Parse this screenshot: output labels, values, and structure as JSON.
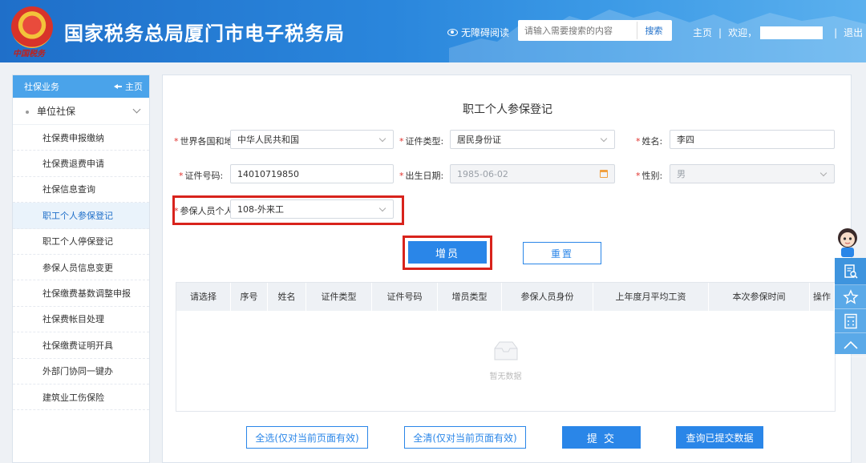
{
  "header": {
    "emblem_subtitle": "中国税务",
    "site_title": "国家税务总局厦门市电子税务局",
    "accessibility_label": "无障碍阅读",
    "search_placeholder": "请输入需要搜索的内容",
    "search_button": "搜索",
    "nav_home": "主页",
    "nav_sep1": "|",
    "welcome": "欢迎，",
    "nav_sep2": "|",
    "logout": "退出"
  },
  "sidebar": {
    "title": "社保业务",
    "home_link": "主页",
    "group": "单位社保",
    "items": [
      {
        "label": "社保费申报缴纳"
      },
      {
        "label": "社保费退费申请"
      },
      {
        "label": "社保信息查询"
      },
      {
        "label": "职工个人参保登记",
        "active": true
      },
      {
        "label": "职工个人停保登记"
      },
      {
        "label": "参保人员信息变更"
      },
      {
        "label": "社保缴费基数调整申报"
      },
      {
        "label": "社保费帐目处理"
      },
      {
        "label": "社保缴费证明开具"
      },
      {
        "label": "外部门协同一键办"
      },
      {
        "label": "建筑业工伤保险"
      }
    ]
  },
  "form": {
    "title": "职工个人参保登记",
    "required_mark": "*",
    "country_label": "世界各国和地",
    "country_value": "中华人民共和国",
    "id_type_label": "证件类型:",
    "id_type_value": "居民身份证",
    "name_label": "姓名:",
    "name_value": "李四",
    "id_number_label": "证件号码:",
    "id_number_value": "14010719850",
    "birth_label": "出生日期:",
    "birth_value": "1985-06-02",
    "gender_label": "性别:",
    "gender_value": "男",
    "person_type_label": "参保人员个人",
    "person_type_value": "108-外来工",
    "add_button": "增员",
    "reset_button": "重置"
  },
  "table": {
    "columns": [
      "请选择",
      "序号",
      "姓名",
      "证件类型",
      "证件号码",
      "增员类型",
      "参保人员身份",
      "上年度月平均工资",
      "本次参保时间",
      "操作"
    ],
    "empty_text": "暂无数据"
  },
  "footer_buttons": {
    "select_all": "全选(仅对当前页面有效)",
    "clear_all": "全清(仅对当前页面有效)",
    "submit": "提 交",
    "query_submitted": "查询已提交数据"
  },
  "colors": {
    "header_blue": "#2a86dc",
    "primary_button": "#2a86e8",
    "highlight_red": "#d8231c",
    "required_red": "#e0302b",
    "sidebar_head": "#4aa3ea"
  },
  "icons": [
    "eye-icon",
    "back-arrow-icon",
    "chevron-down-icon",
    "calendar-icon",
    "empty-box-icon",
    "search-doc-icon",
    "star-icon",
    "calculator-icon",
    "arrow-up-icon"
  ]
}
